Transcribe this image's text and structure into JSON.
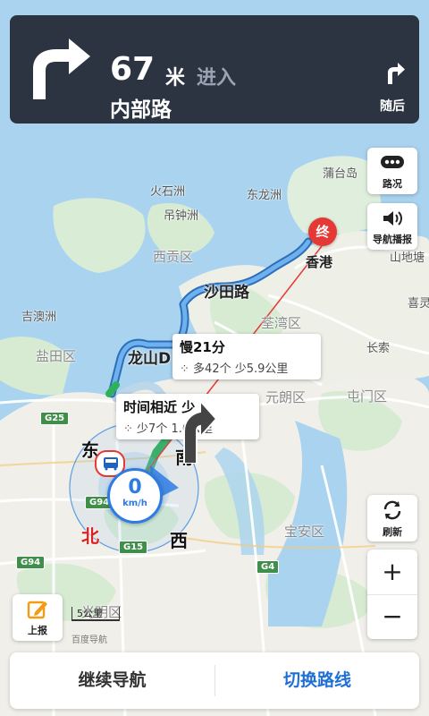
{
  "banner": {
    "distance": "67",
    "distance_unit": "米",
    "action": "进入",
    "road_name": "内部路",
    "next_label": "随后"
  },
  "side_buttons": {
    "overview_label": "路况",
    "voice_label": "导航播报",
    "refresh_label": "刷新",
    "zoom_in": "+",
    "zoom_out": "−",
    "report_label": "上报"
  },
  "scale": {
    "label": "5公里",
    "brand": "百度导航"
  },
  "speed": {
    "value": "0",
    "unit": "km/h"
  },
  "destination_marker": "终",
  "routes": [
    {
      "title": "慢21分",
      "detail": "多42个 少5.9公里"
    },
    {
      "title": "时间相近 少",
      "detail": "少7个 1.6公里"
    }
  ],
  "map_labels": {
    "p1": "蒲台岛",
    "p2": "火石洲",
    "p3": "东龙洲",
    "p4": "吊钟洲",
    "p5": "西贡区",
    "p6": "香港",
    "p7": "山地塘",
    "p8": "沙田路",
    "p9": "吉澳洲",
    "p10": "荃湾区",
    "p11": "喜灵",
    "p12": "盐田区",
    "p13": "龙山D",
    "p14": "长索",
    "p15": "元朗区",
    "p16": "屯门区",
    "p17": "宝安区",
    "p18": "光明区",
    "compass_e": "东",
    "compass_s": "南",
    "compass_n": "北",
    "compass_w": "西",
    "g25": "G25",
    "g94a": "G94",
    "g15": "G15",
    "g94b": "G94",
    "g4": "G4"
  },
  "bottom": {
    "continue": "继续导航",
    "switch": "切换路线"
  },
  "colors": {
    "route": "#4a90e2",
    "accent": "#1f6fd6",
    "banner": "#2c3442",
    "marker": "#e53935"
  }
}
